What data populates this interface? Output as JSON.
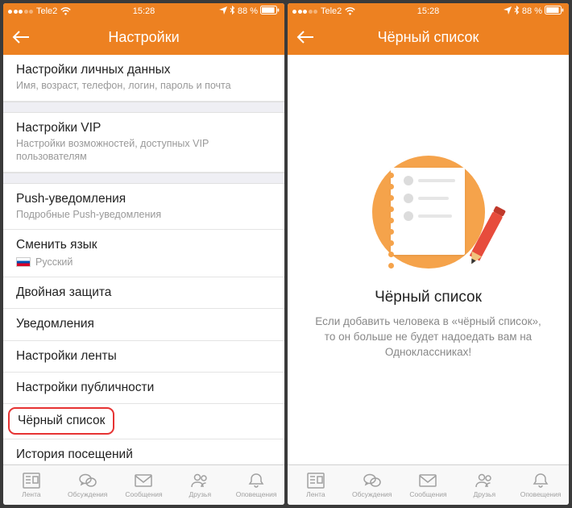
{
  "status": {
    "carrier": "Tele2",
    "time": "15:28",
    "battery": "88 %"
  },
  "left": {
    "title": "Настройки",
    "groups": [
      [
        {
          "title": "Настройки личных данных",
          "sub": "Имя, возраст, телефон, логин, пароль и почта"
        }
      ],
      [
        {
          "title": "Настройки VIP",
          "sub": "Настройки возможностей, доступных VIP пользователям"
        }
      ],
      [
        {
          "title": "Push-уведомления",
          "sub": "Подробные Push-уведомления"
        },
        {
          "title": "Сменить язык",
          "lang": "Русский"
        },
        {
          "title": "Двойная защита"
        },
        {
          "title": "Уведомления"
        },
        {
          "title": "Настройки ленты"
        },
        {
          "title": "Настройки публичности"
        },
        {
          "title": "Чёрный список",
          "highlight": true
        },
        {
          "title": "История посещений"
        }
      ]
    ]
  },
  "right": {
    "title": "Чёрный список",
    "empty_title": "Чёрный список",
    "empty_text": "Если добавить человека в «чёрный список», то он больше не будет надоедать вам на Одноклассниках!"
  },
  "tabs": [
    {
      "label": "Лента"
    },
    {
      "label": "Обсуждения"
    },
    {
      "label": "Сообщения"
    },
    {
      "label": "Друзья"
    },
    {
      "label": "Оповещения"
    }
  ]
}
